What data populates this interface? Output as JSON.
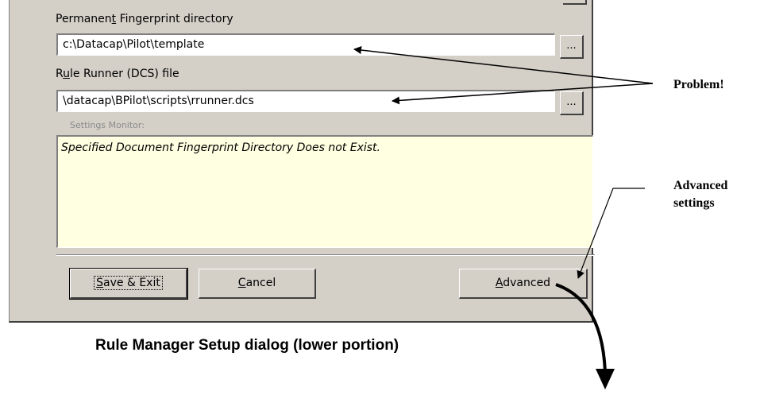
{
  "dialog": {
    "fingerprint_dir": {
      "label_pre": "Permanen",
      "label_ul": "t",
      "label_post": " Fingerprint directory",
      "value": "c:\\Datacap\\Pilot\\template",
      "browse": "..."
    },
    "rule_runner": {
      "label_pre": "R",
      "label_ul": "u",
      "label_post": "le Runner (DCS) file",
      "value": "\\datacap\\BPilot\\scripts\\rrunner.dcs",
      "browse": "..."
    },
    "settings_monitor": {
      "label": "Settings Monitor:",
      "message": "Specified Document Fingerprint Directory Does not Exist."
    },
    "buttons": {
      "save": {
        "ul": "S",
        "rest": "ave & Exit"
      },
      "cancel": {
        "ul": "C",
        "rest": "ancel"
      },
      "advanced": {
        "ul": "A",
        "rest": "dvanced"
      }
    }
  },
  "annotations": {
    "problem": "Problem!",
    "advanced_line1": "Advanced",
    "advanced_line2": "settings",
    "caption": "Rule Manager Setup dialog (lower portion)"
  },
  "colors": {
    "dialog_bg": "#d4d0c8",
    "monitor_bg": "#ffffe1"
  }
}
